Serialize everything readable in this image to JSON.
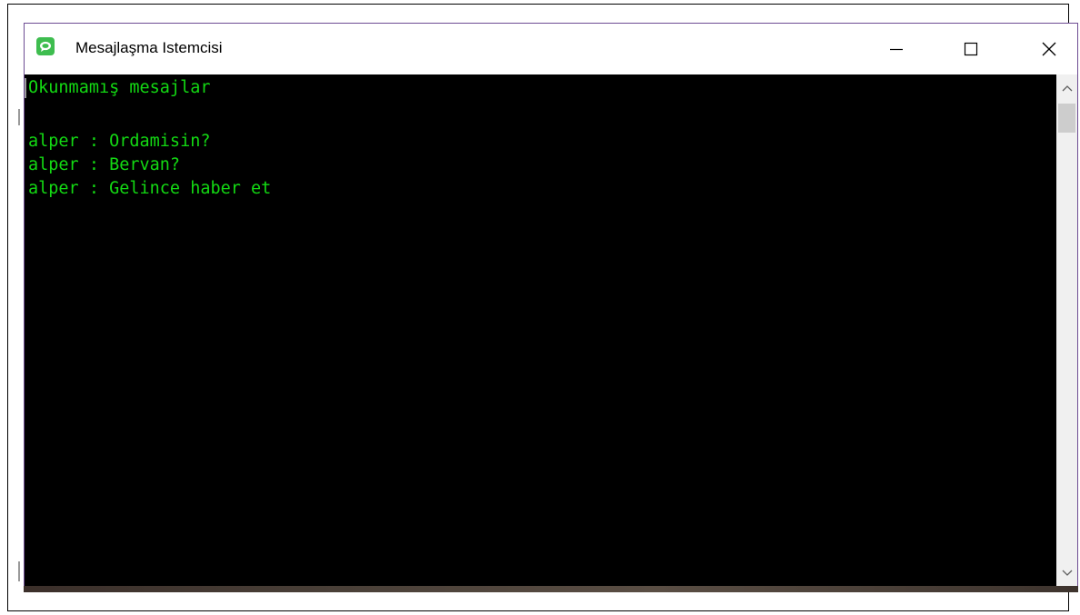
{
  "window": {
    "title": "Mesajlaşma Istemcisi",
    "icon": "chat-bubble-icon",
    "controls": {
      "minimize": "minimize-icon",
      "maximize": "maximize-icon",
      "close": "close-icon"
    }
  },
  "console": {
    "text_color": "#13d913",
    "background": "#000000",
    "lines": [
      "Okunmamış mesajlar",
      "",
      "alper : Ordamisin?",
      "alper : Bervan?",
      "alper : Gelince haber et"
    ]
  },
  "scrollbar": {
    "up_icon": "chevron-up-icon",
    "down_icon": "chevron-down-icon"
  },
  "colors": {
    "window_border": "#6d4c93",
    "app_icon": "#3ebd4f"
  }
}
